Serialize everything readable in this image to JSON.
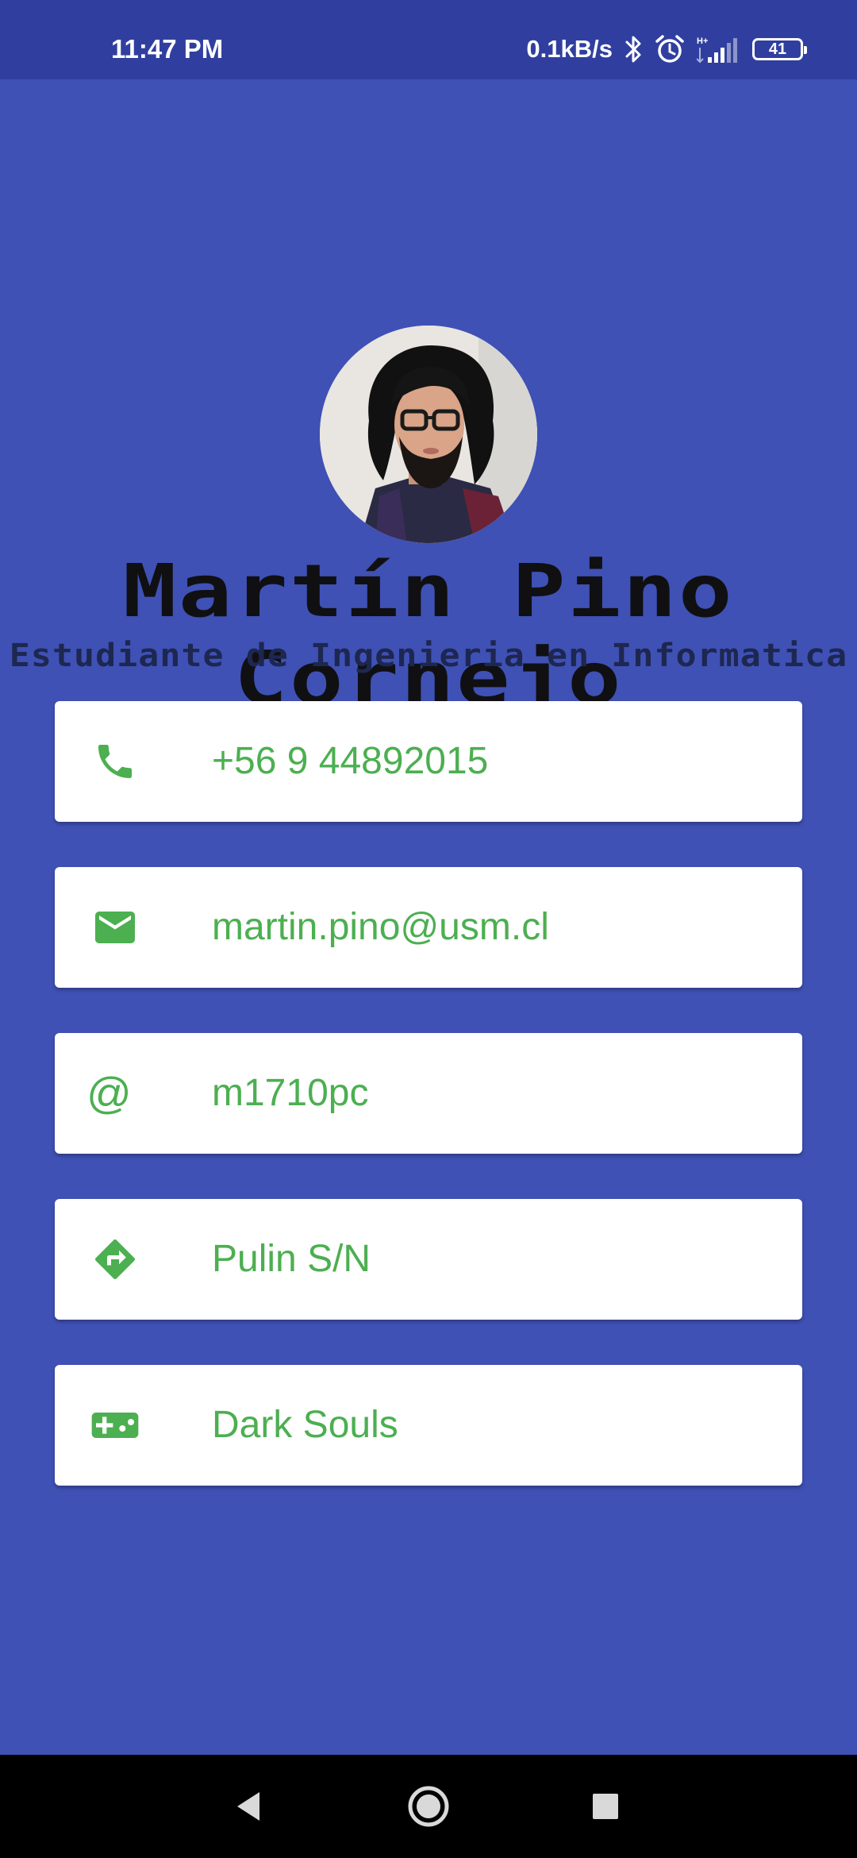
{
  "status_bar": {
    "time": "11:47 PM",
    "net_speed": "0.1kB/s",
    "battery_level": "41",
    "icons": [
      "bluetooth-icon",
      "alarm-icon",
      "signal-icon",
      "battery-icon"
    ]
  },
  "profile": {
    "name": "Martín Pino Cornejo",
    "title": "Estudiante de Ingenieria en Informatica"
  },
  "contacts": [
    {
      "icon": "phone-icon",
      "text": "+56 9 44892015"
    },
    {
      "icon": "email-icon",
      "text": "martin.pino@usm.cl"
    },
    {
      "icon": "at-icon",
      "glyph": "@",
      "text": "m1710pc"
    },
    {
      "icon": "directions-icon",
      "text": "Pulin S/N"
    },
    {
      "icon": "gamepad-icon",
      "text": "Dark Souls"
    }
  ],
  "nav_bar": {
    "icons": [
      "back-icon",
      "home-icon",
      "recents-icon"
    ]
  },
  "colors": {
    "background": "#3f51b5",
    "status_bar": "#303f9f",
    "accent": "#4caf50",
    "card": "#ffffff",
    "nav_bar": "#000000"
  }
}
